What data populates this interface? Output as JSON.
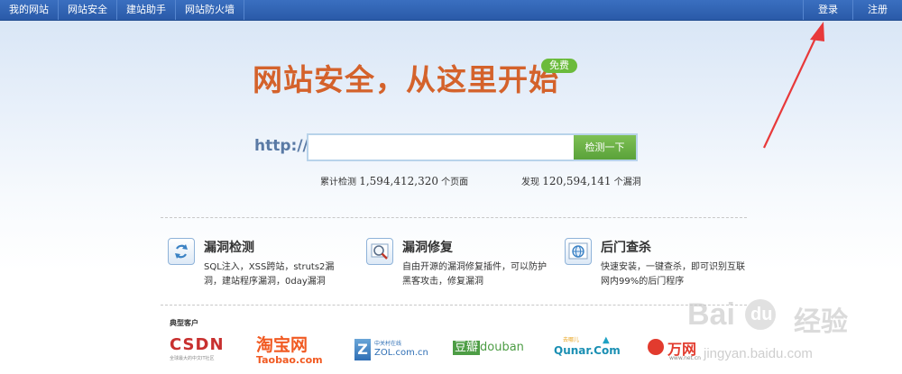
{
  "topnav": {
    "items": [
      "我的网站",
      "网站安全",
      "建站助手",
      "网站防火墙"
    ],
    "login": "登录",
    "register": "注册"
  },
  "hero": {
    "headline": "网站安全，从这里开始",
    "badge": "免费",
    "http_label": "http://",
    "url_value": "",
    "check_button": "检测一下"
  },
  "stats": {
    "checked_prefix": "累计检测",
    "checked_count": "1,594,412,320",
    "checked_suffix": "个页面",
    "found_prefix": "发现",
    "found_count": "120,594,141",
    "found_suffix": "个漏洞"
  },
  "features": [
    {
      "icon": "refresh-icon",
      "title": "漏洞检测",
      "desc": "SQL注入，XSS跨站，struts2漏洞，建站程序漏洞，0day漏洞"
    },
    {
      "icon": "magnifier-icon",
      "title": "漏洞修复",
      "desc": "自由开源的漏洞修复插件，可以防护黑客攻击，修复漏洞"
    },
    {
      "icon": "globe-icon",
      "title": "后门查杀",
      "desc": "快速安装，一键查杀，即可识别互联网内99%的后门程序"
    }
  ],
  "customers": {
    "title": "典型客户",
    "logos": [
      {
        "name": "CSDN",
        "sub": "全球最大的中文IT社区"
      },
      {
        "name": "淘宝网",
        "sub": "Taobao.com"
      },
      {
        "name": "中关村在线",
        "sub": "ZOL.com.cn"
      },
      {
        "name": "豆瓣",
        "sub": "douban"
      },
      {
        "name": "去哪儿",
        "sub": "Qunar.Com"
      },
      {
        "name": "万网",
        "sub": "www.net.cn"
      }
    ]
  },
  "watermark": {
    "brand_latin": "Bai",
    "brand_du": "du",
    "brand_cn": "经验",
    "url": "jingyan.baidu.com"
  },
  "colors": {
    "topbar": "#2a5aa8",
    "headline": "#d4622b",
    "accent_green": "#5aa23a",
    "arrow": "#e8393a"
  }
}
